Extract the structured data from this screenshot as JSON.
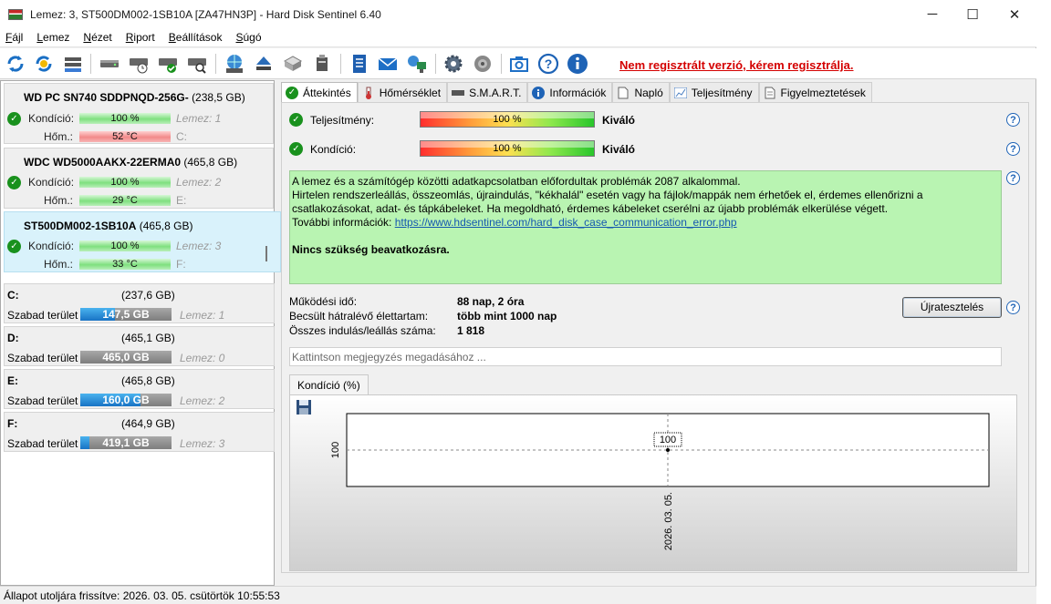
{
  "window": {
    "title": "Lemez: 3, ST500DM002-1SB10A [ZA47HN3P]  -  Hard Disk Sentinel 6.40",
    "minimize": "─",
    "maximize": "☐",
    "close": "✕"
  },
  "menu": [
    "Fájl",
    "Lemez",
    "Nézet",
    "Riport",
    "Beállítások",
    "Súgó"
  ],
  "toolbar": {
    "icons": [
      "refresh-icon",
      "refresh-all-icon",
      "disk-list-icon",
      "disk-icon",
      "disk-clock-icon",
      "disk-check-icon",
      "disk-search-icon",
      "globe-disk-icon",
      "eject-icon",
      "disk-stack-icon",
      "usb-disk-icon",
      "report-icon",
      "email-icon",
      "network-icon",
      "settings-icon",
      "sound-icon",
      "camera-icon",
      "help-icon",
      "info-icon"
    ],
    "unregistered": "Nem regisztrált verzió, kérem regisztrálja."
  },
  "disks": [
    {
      "name_bold": "WD PC SN740 SDDPNQD-256G-",
      "size": "(238,5 GB)",
      "cond_label": "Kondíció:",
      "cond": "100 %",
      "cond_fraction": 1.0,
      "temp_label": "Hőm.:",
      "temp": "52 °C",
      "temp_status": "red",
      "ghost1": "Lemez: 1",
      "ghost2": "C:"
    },
    {
      "name_bold": "WDC WD5000AAKX-22ERMA0",
      "size": "(465,8 GB)",
      "cond_label": "Kondíció:",
      "cond": "100 %",
      "cond_fraction": 1.0,
      "temp_label": "Hőm.:",
      "temp": "29 °C",
      "temp_status": "green",
      "ghost1": "Lemez: 2",
      "ghost2": "E:"
    },
    {
      "name_bold": "ST500DM002-1SB10A",
      "size": "(465,8 GB)",
      "cond_label": "Kondíció:",
      "cond": "100 %",
      "cond_fraction": 1.0,
      "temp_label": "Hőm.:",
      "temp": "33 °C",
      "temp_status": "green",
      "ghost1": "Lemez: 3",
      "ghost2": "F:"
    }
  ],
  "drives": [
    {
      "letter": "C:",
      "size": "(237,6 GB)",
      "free_label": "Szabad terület",
      "free": "147,5 GB",
      "used_fraction": 0.38,
      "ghost": "Lemez: 1"
    },
    {
      "letter": "D:",
      "size": "(465,1 GB)",
      "free_label": "Szabad terület",
      "free": "465,0 GB",
      "used_fraction": 0.0,
      "ghost": "Lemez: 0"
    },
    {
      "letter": "E:",
      "size": "(465,8 GB)",
      "free_label": "Szabad terület",
      "free": "160,0 GB",
      "used_fraction": 0.66,
      "ghost": "Lemez: 2"
    },
    {
      "letter": "F:",
      "size": "(464,9 GB)",
      "free_label": "Szabad terület",
      "free": "419,1 GB",
      "used_fraction": 0.1,
      "ghost": "Lemez: 3"
    }
  ],
  "tabs": [
    "Áttekintés",
    "Hőmérséklet",
    "S.M.A.R.T.",
    "Információk",
    "Napló",
    "Teljesítmény",
    "Figyelmeztetések"
  ],
  "overview": {
    "perf_label": "Teljesítmény:",
    "perf_value": "100 %",
    "perf_rating": "Kiváló",
    "cond_label": "Kondíció:",
    "cond_value": "100 %",
    "cond_rating": "Kiváló",
    "msg_line1": "A lemez és a számítógép közötti adatkapcsolatban előfordultak problémák 2087 alkalommal.",
    "msg_line2": "Hirtelen rendszerleállás, összeomlás, újraindulás, \"kékhalál\" esetén vagy ha fájlok/mappák nem érhetőek el, érdemes ellenőrizni a csatlakozásokat, adat- és tápkábeleket. Ha megoldható, érdemes kábeleket cserélni az újabb problémák elkerülése végett.",
    "msg_more_label": "További információk: ",
    "msg_link": "https://www.hdsentinel.com/hard_disk_case_communication_error.php",
    "msg_action": "Nincs szükség beavatkozásra.",
    "uptime_label": "Működési idő:",
    "uptime_value": "88 nap, 2 óra",
    "life_label": "Becsült hátralévő élettartam:",
    "life_value": "több mint 1000 nap",
    "starts_label": "Összes indulás/leállás száma:",
    "starts_value": "1 818",
    "retest_button": "Újratesztelés",
    "note_placeholder": "Kattintson megjegyzés megadásához ...",
    "chart_tab": "Kondíció  (%)",
    "help": "?"
  },
  "chart_data": {
    "type": "line",
    "x": [
      "2026. 03. 05."
    ],
    "series": [
      {
        "values": [
          100
        ]
      }
    ],
    "ytick_labels": [
      "100"
    ],
    "data_labels": [
      "100"
    ]
  },
  "statusbar": "Állapot utoljára frissítve: 2026. 03. 05. csütörtök 10:55:53"
}
